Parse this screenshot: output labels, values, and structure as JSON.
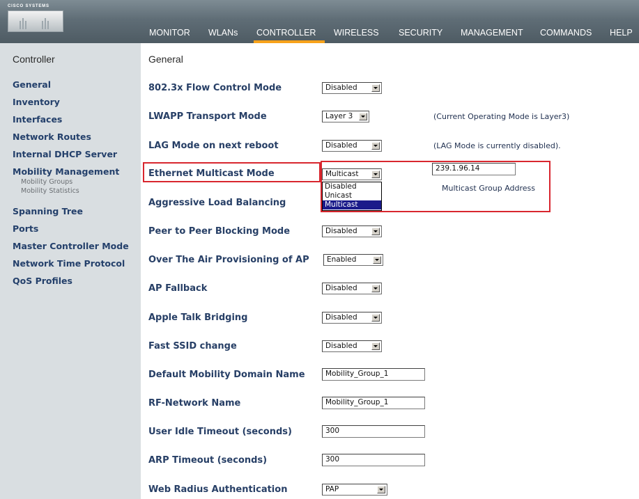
{
  "brand": {
    "logo_text": "Cisco Systems"
  },
  "nav": {
    "items": [
      {
        "label": "MONITOR"
      },
      {
        "label": "WLANs"
      },
      {
        "label": "CONTROLLER"
      },
      {
        "label": "WIRELESS"
      },
      {
        "label": "SECURITY"
      },
      {
        "label": "MANAGEMENT"
      },
      {
        "label": "COMMANDS"
      },
      {
        "label": "HELP"
      }
    ],
    "active": "CONTROLLER",
    "active_color": "#f7a21b"
  },
  "sidebar": {
    "title": "Controller",
    "items": [
      {
        "label": "General"
      },
      {
        "label": "Inventory"
      },
      {
        "label": "Interfaces"
      },
      {
        "label": "Network Routes"
      },
      {
        "label": "Internal DHCP Server"
      },
      {
        "label": "Mobility Management"
      },
      {
        "label": "Mobility Groups"
      },
      {
        "label": "Mobility Statistics"
      },
      {
        "label": "Spanning Tree"
      },
      {
        "label": "Ports"
      },
      {
        "label": "Master Controller Mode"
      },
      {
        "label": "Network Time Protocol"
      },
      {
        "label": "QoS Profiles"
      }
    ]
  },
  "main": {
    "title": "General",
    "rows": [
      {
        "label": "802.3x Flow Control Mode",
        "value": "Disabled"
      },
      {
        "label": "LWAPP Transport Mode",
        "value": "Layer 3",
        "note": "(Current Operating Mode is Layer3)"
      },
      {
        "label": "LAG Mode on next reboot",
        "value": "Disabled",
        "note": "(LAG Mode is currently disabled)."
      },
      {
        "label": "Ethernet Multicast Mode",
        "value": "Multicast",
        "address_value": "239.1.96.14",
        "address_label": "Multicast Group Address"
      },
      {
        "label": "Aggressive Load Balancing"
      },
      {
        "label": "Peer to Peer Blocking Mode",
        "value": "Disabled"
      },
      {
        "label": "Over The Air Provisioning of AP",
        "value": "Enabled"
      },
      {
        "label": "AP Fallback",
        "value": "Disabled"
      },
      {
        "label": "Apple Talk Bridging",
        "value": "Disabled"
      },
      {
        "label": "Fast SSID change",
        "value": "Disabled"
      },
      {
        "label": "Default Mobility Domain Name",
        "value": "Mobility_Group_1"
      },
      {
        "label": "RF-Network Name",
        "value": "Mobility_Group_1"
      },
      {
        "label": "User Idle Timeout (seconds)",
        "value": "300"
      },
      {
        "label": "ARP Timeout (seconds)",
        "value": "300"
      },
      {
        "label": "Web Radius Authentication",
        "value": "PAP"
      }
    ],
    "multicast_dropdown": {
      "options": [
        "Disabled",
        "Unicast",
        "Multicast"
      ],
      "selected": "Multicast"
    }
  },
  "colors": {
    "highlight": "#d8262e",
    "label_text": "#273f66",
    "sidebar_bg": "#d9dee1",
    "selected_option_bg": "#1b1b8a"
  }
}
